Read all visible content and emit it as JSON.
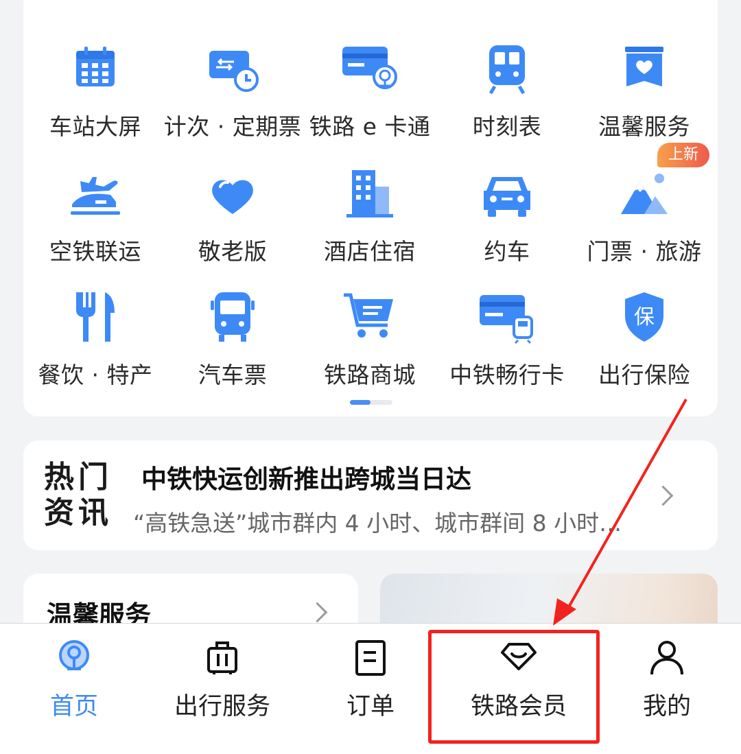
{
  "grid": {
    "items": [
      {
        "label": "车站大屏",
        "icon": "station-screen-icon"
      },
      {
        "label": "计次 · 定期票",
        "icon": "ticket-clock-icon"
      },
      {
        "label": "铁路 e 卡通",
        "icon": "railway-card-icon"
      },
      {
        "label": "时刻表",
        "icon": "train-timetable-icon"
      },
      {
        "label": "温馨服务",
        "icon": "heart-service-icon"
      },
      {
        "label": "空铁联运",
        "icon": "air-rail-icon"
      },
      {
        "label": "敬老版",
        "icon": "heart-icon"
      },
      {
        "label": "酒店住宿",
        "icon": "hotel-building-icon"
      },
      {
        "label": "约车",
        "icon": "car-icon"
      },
      {
        "label": "门票 · 旅游",
        "icon": "mountain-travel-icon"
      },
      {
        "label": "餐饮 · 特产",
        "icon": "fork-knife-icon"
      },
      {
        "label": "汽车票",
        "icon": "bus-icon"
      },
      {
        "label": "铁路商城",
        "icon": "shopping-cart-icon"
      },
      {
        "label": "中铁畅行卡",
        "icon": "rail-pass-card-icon"
      },
      {
        "label": "出行保险",
        "icon": "insurance-shield-icon"
      }
    ],
    "new_badge": "上新",
    "accent": "#3d8af7"
  },
  "news": {
    "tag_line1": "热门",
    "tag_line2": "资讯",
    "title": "中铁快运创新推出跨城当日达",
    "subtitle": "“高铁急送”城市群内 4 小时、城市群间 8 小时…"
  },
  "service": {
    "title": "温馨服务"
  },
  "tabs": [
    {
      "label": "首页",
      "icon": "home-rail-logo-icon",
      "active": true
    },
    {
      "label": "出行服务",
      "icon": "luggage-icon"
    },
    {
      "label": "订单",
      "icon": "order-doc-icon"
    },
    {
      "label": "铁路会员",
      "icon": "diamond-icon"
    },
    {
      "label": "我的",
      "icon": "user-icon"
    }
  ],
  "annotation_color": "#f2231e"
}
